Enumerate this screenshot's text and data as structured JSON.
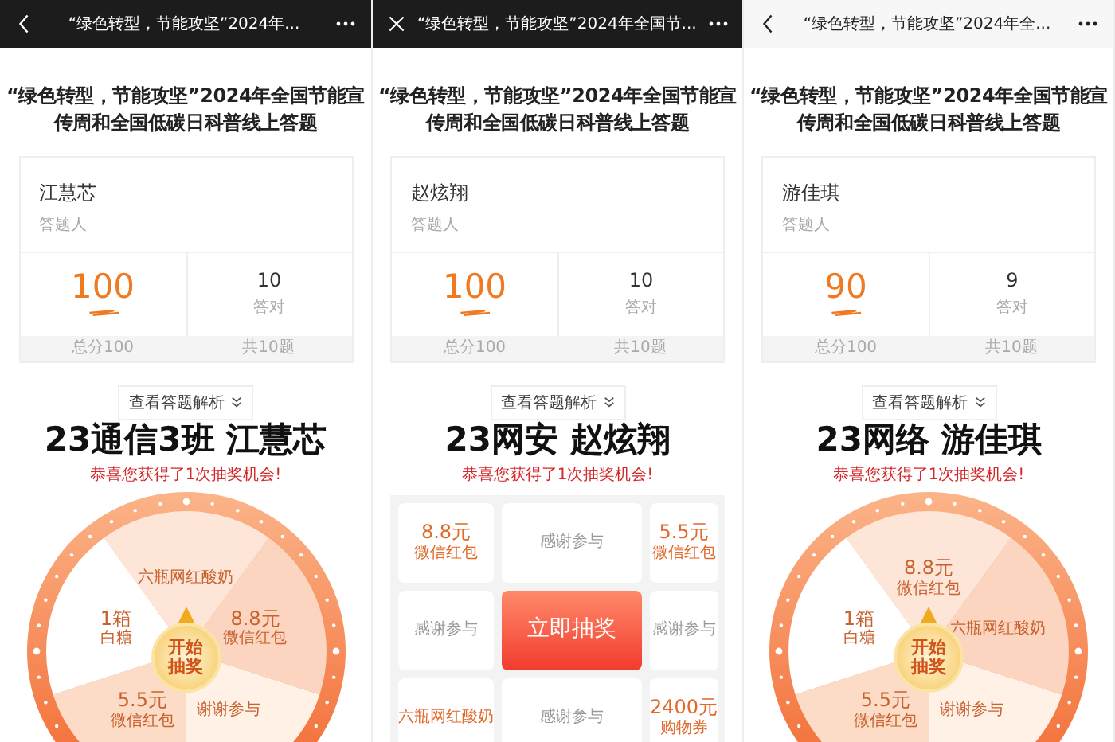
{
  "panels": [
    {
      "nav": {
        "kind": "back",
        "dark": true,
        "title": "“绿色转型，节能攻坚”2024年..."
      },
      "heading": "“绿色转型，节能攻坚”2024年全国节能宣传周和全国低碳日科普线上答题",
      "card": {
        "name": "江慧芯",
        "role": "答题人",
        "score": "100",
        "correct": "10",
        "correct_label": "答对",
        "total_score": "总分100",
        "total_questions": "共10题"
      },
      "review_button": "查看答题解析",
      "result_title": "23通信3班 江慧芯",
      "prize_message": "恭喜您获得了1次抽奖机会!",
      "lottery": {
        "kind": "wheel",
        "start_button": "开始抽奖",
        "segments": [
          {
            "lines": [
              "六瓶网红酸奶"
            ]
          },
          {
            "lines": [
              "8.8元",
              "微信红包"
            ]
          },
          {
            "lines": [
              "谢谢参与"
            ]
          },
          {
            "lines": [
              "5.5元",
              "微信红包"
            ]
          },
          {
            "lines": [
              "1箱",
              "白糖"
            ]
          }
        ]
      }
    },
    {
      "nav": {
        "kind": "close",
        "dark": true,
        "title": "“绿色转型，节能攻坚”2024年全国节..."
      },
      "heading": "“绿色转型，节能攻坚”2024年全国节能宣传周和全国低碳日科普线上答题",
      "card": {
        "name": "赵炫翔",
        "role": "答题人",
        "score": "100",
        "correct": "10",
        "correct_label": "答对",
        "total_score": "总分100",
        "total_questions": "共10题"
      },
      "review_button": "查看答题解析",
      "result_title": "23网安 赵炫翔",
      "prize_message": "恭喜您获得了1次抽奖机会!",
      "lottery": {
        "kind": "grid",
        "cells": [
          {
            "kind": "prize",
            "lines": [
              "8.8元",
              "微信红包"
            ]
          },
          {
            "kind": "thanks",
            "lines": [
              "感谢参与"
            ]
          },
          {
            "kind": "prize",
            "lines": [
              "5.5元",
              "微信红包"
            ]
          },
          {
            "kind": "thanks",
            "lines": [
              "感谢参与"
            ]
          },
          {
            "kind": "start",
            "lines": [
              "立即",
              "抽奖"
            ]
          },
          {
            "kind": "thanks",
            "lines": [
              "感谢参与"
            ]
          },
          {
            "kind": "prize",
            "lines": [
              "六瓶网红酸奶"
            ]
          },
          {
            "kind": "thanks",
            "lines": [
              "感谢参与"
            ]
          },
          {
            "kind": "prize",
            "lines": [
              "2400元",
              "购物券"
            ]
          }
        ]
      }
    },
    {
      "nav": {
        "kind": "back",
        "dark": false,
        "title": "“绿色转型，节能攻坚”2024年全..."
      },
      "heading": "“绿色转型，节能攻坚”2024年全国节能宣传周和全国低碳日科普线上答题",
      "card": {
        "name": "游佳琪",
        "role": "答题人",
        "score": "90",
        "correct": "9",
        "correct_label": "答对",
        "total_score": "总分100",
        "total_questions": "共10题"
      },
      "review_button": "查看答题解析",
      "result_title": "23网络 游佳琪",
      "prize_message": "恭喜您获得了1次抽奖机会!",
      "lottery": {
        "kind": "wheel",
        "start_button": "开始抽奖",
        "segments": [
          {
            "lines": [
              "8.8元",
              "微信红包"
            ]
          },
          {
            "lines": [
              "六瓶网红酸奶"
            ]
          },
          {
            "lines": [
              "谢谢参与"
            ]
          },
          {
            "lines": [
              "5.5元",
              "微信红包"
            ]
          },
          {
            "lines": [
              "1箱",
              "白糖"
            ]
          }
        ]
      }
    }
  ]
}
